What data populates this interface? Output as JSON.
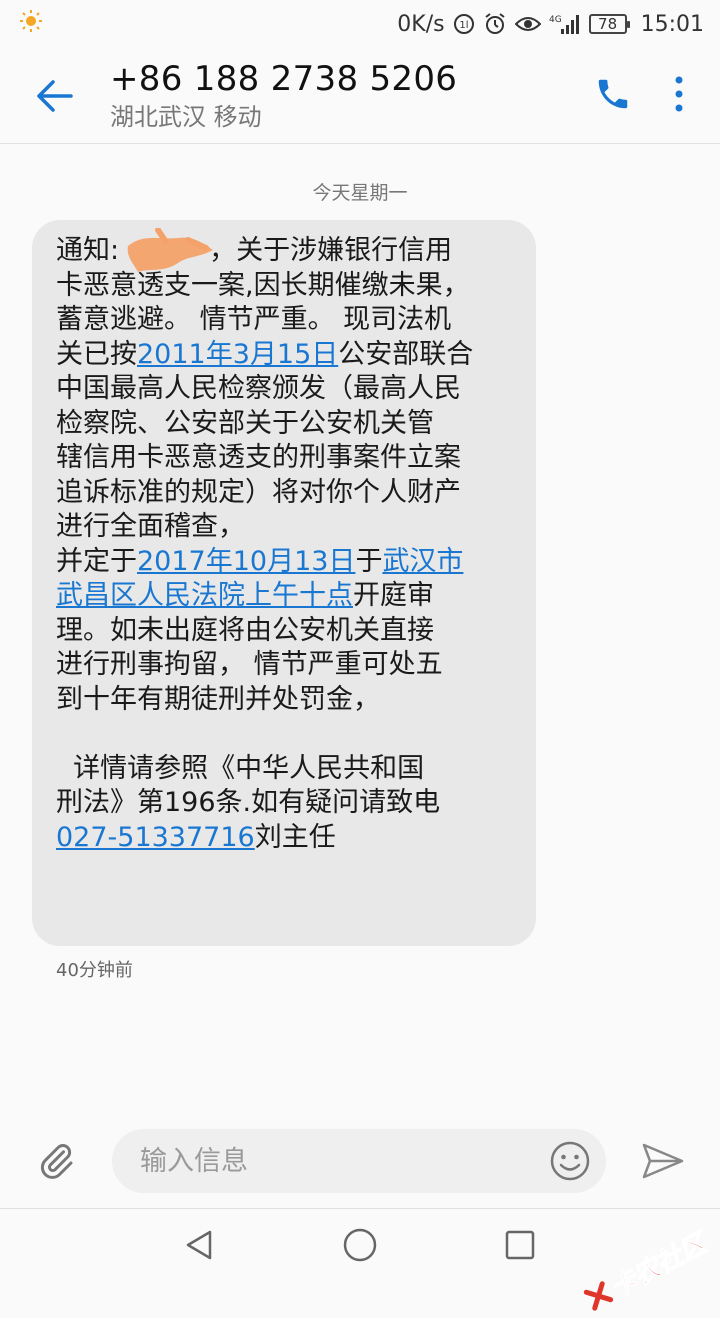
{
  "status_bar": {
    "speed": "0K/s",
    "network": "4G",
    "battery": "78",
    "time": "15:01"
  },
  "header": {
    "contact_number": "+86 188 2738 5206",
    "contact_location": "湖北武汉 移动"
  },
  "conversation": {
    "date_label": "今天星期一",
    "message": {
      "lines": {
        "l1a": "通知:",
        "l1b": "，关于涉嫌银行信用",
        "l2": "卡恶意透支一案,因长期催缴未果，",
        "l3": "蓄意逃避。 情节严重。 现司法机",
        "l4a": "关已按",
        "l4link": "2011年3月15日",
        "l4b": "公安部联合",
        "l5": "中国最高人民检察颁发（最高人民",
        "l6": "检察院、公安部关于公安机关管",
        "l7": "辖信用卡恶意透支的刑事案件立案",
        "l8": "追诉标准的规定）将对你个人财产",
        "l9": "进行全面稽查，",
        "l10a": "并定于",
        "l10link1": "2017年10月13日",
        "l10b": "于",
        "l10link2": "武汉市",
        "l11link": "武昌区人民法院上午十点",
        "l11b": "开庭审",
        "l12": "理。如未出庭将由公安机关直接",
        "l13": "进行刑事拘留， 情节严重可处五",
        "l14": "到十年有期徒刑并处罚金，",
        "l16": "  详情请参照《中华人民共和国",
        "l17": "刑法》第196条.如有疑问请致电",
        "l18link": "027-51337716",
        "l18b": "刘主任"
      }
    },
    "timestamp": "40分钟前"
  },
  "input_bar": {
    "placeholder": "输入信息"
  },
  "watermark": {
    "text": "卡农社区"
  },
  "colors": {
    "accent": "#1977d2",
    "bubble": "#e8e8e8",
    "watermark": "#e0352a"
  }
}
